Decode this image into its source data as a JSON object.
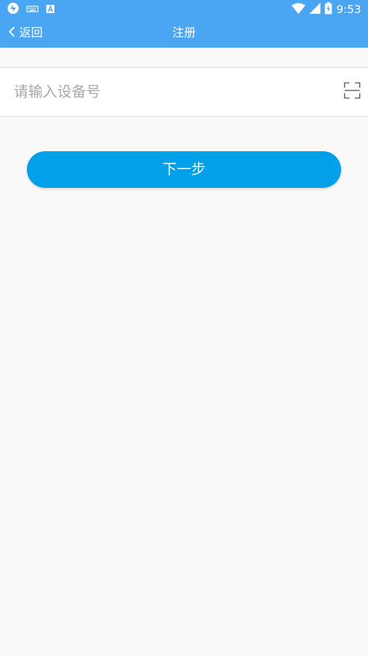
{
  "status_bar": {
    "time": "9:53",
    "icons": [
      "sync-icon",
      "keyboard-icon",
      "app-a-icon",
      "wifi-icon",
      "signal-icon",
      "battery-charging-icon"
    ]
  },
  "nav_bar": {
    "back_label": "返回",
    "title": "注册"
  },
  "device_input": {
    "value": "",
    "placeholder": "请输入设备号"
  },
  "next_button": {
    "label": "下一步"
  },
  "colors": {
    "primary": "#4aa6f3",
    "button": "#02a0e8",
    "background": "#f9f9f9"
  }
}
